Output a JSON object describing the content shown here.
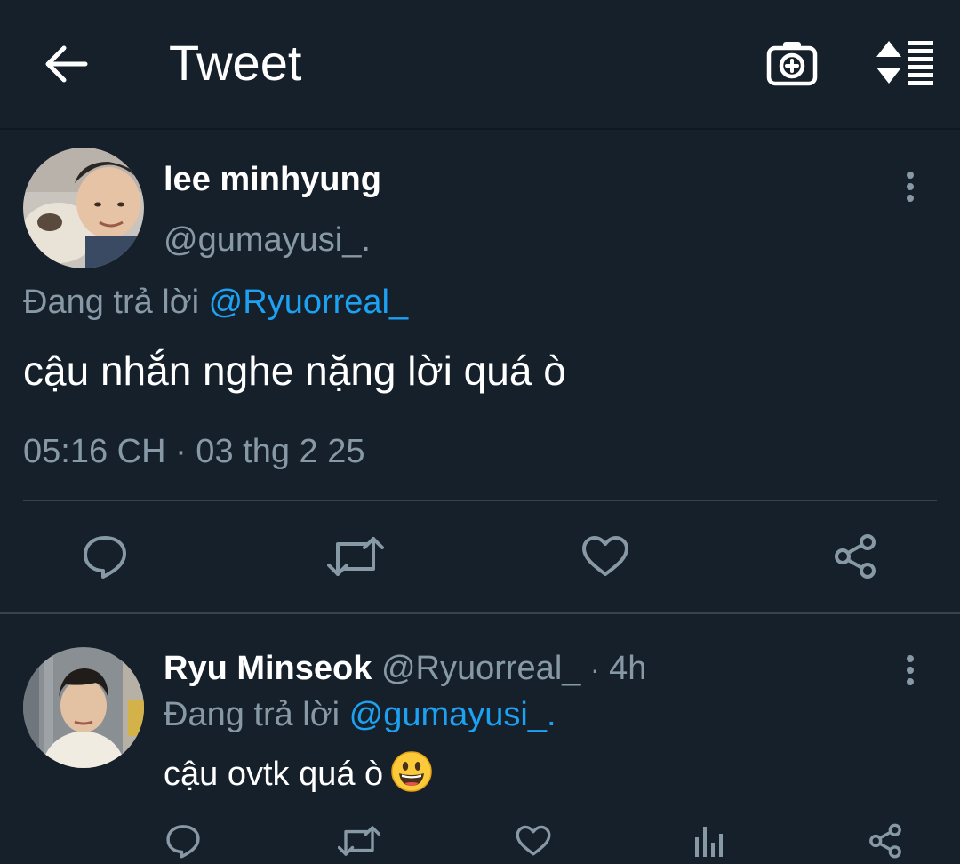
{
  "header": {
    "title": "Tweet",
    "back_icon": "arrow-left-icon",
    "camera_icon": "camera-plus-icon",
    "sort_icon": "sort-lines-icon"
  },
  "tweet": {
    "display_name": "lee minhyung",
    "handle": "@gumayusi_.",
    "replying_prefix": "Đang trả lời",
    "replying_to": "@Ryuorreal_",
    "text": "cậu nhắn nghe nặng lời quá ò",
    "timestamp": "05:16 CH · 03 thg 2 25",
    "actions": [
      "reply-icon",
      "retweet-icon",
      "like-icon",
      "share-icon"
    ],
    "more_icon": "more-vertical-icon"
  },
  "reply": {
    "display_name": "Ryu Minseok",
    "handle": "@Ryuorreal_",
    "time_sep": "·",
    "time": "4h",
    "replying_prefix": "Đang trả lời",
    "replying_to": "@gumayusi_.",
    "text": "cậu ovtk quá ò",
    "emoji": "smiling-face-emoji",
    "actions": [
      "reply-icon",
      "retweet-icon",
      "like-icon",
      "analytics-icon",
      "share-icon"
    ],
    "more_icon": "more-vertical-icon"
  },
  "colors": {
    "background": "#15202b",
    "text_primary": "#ffffff",
    "text_secondary": "#8899a6",
    "accent": "#1da1f2",
    "divider": "#38444d"
  }
}
